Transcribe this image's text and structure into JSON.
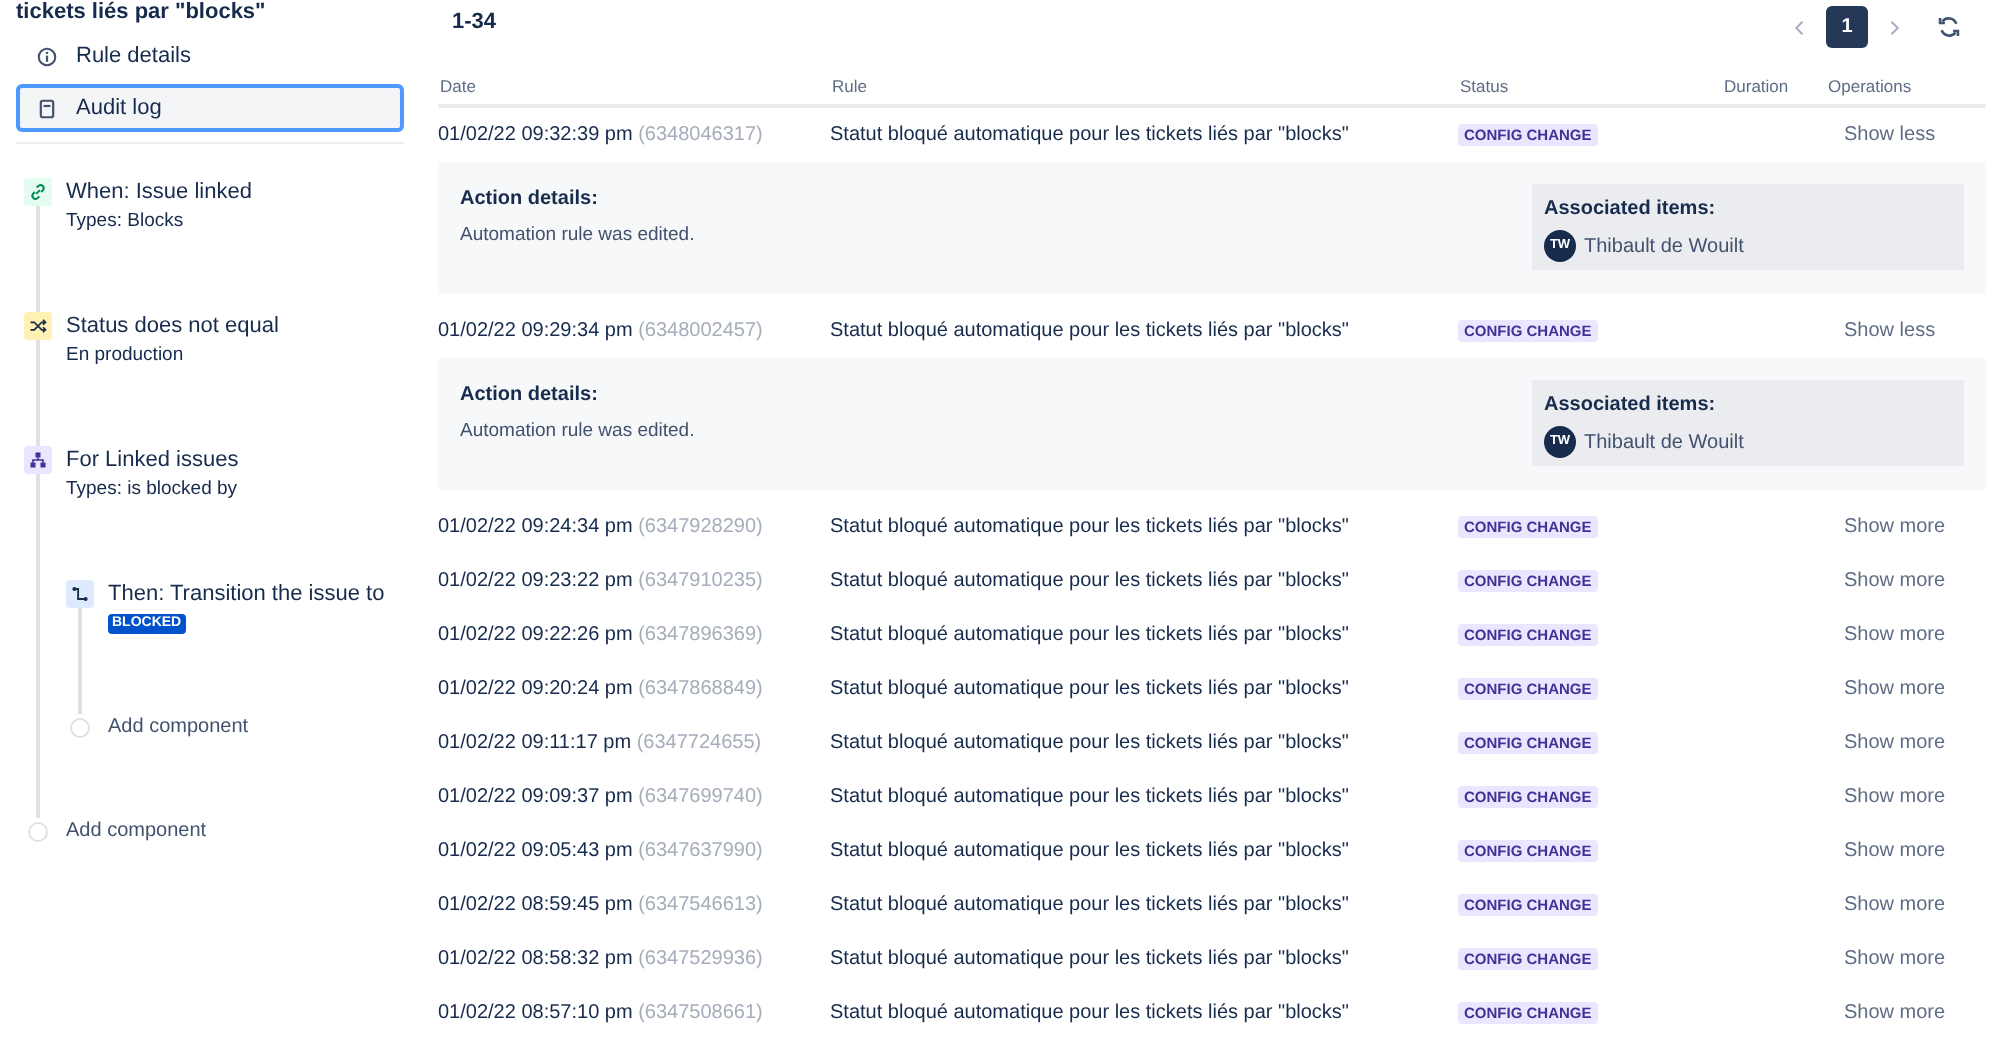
{
  "rule_title": "tickets liés par \"blocks\"",
  "nav": [
    {
      "kind": "info",
      "label": "Rule details",
      "selected": false
    },
    {
      "kind": "log",
      "label": "Audit log",
      "selected": true
    }
  ],
  "flow": [
    {
      "kind": "trigger",
      "title": "When: Issue linked",
      "detail": "Types: Blocks"
    },
    {
      "kind": "condition",
      "title": "Status does not equal",
      "detail": "En production"
    },
    {
      "kind": "branch",
      "title": "For Linked issues",
      "detail": "Types: is blocked by",
      "children": [
        {
          "kind": "action",
          "title": "Then: Transition the issue to",
          "lozenge": "BLOCKED"
        },
        {
          "kind": "add",
          "title": "Add component"
        }
      ]
    },
    {
      "kind": "add",
      "title": "Add component"
    }
  ],
  "audit_log": {
    "range": "1-34",
    "pages": [
      {
        "label": "1",
        "selected": true
      }
    ],
    "columns": [
      "Date",
      "Rule",
      "Status",
      "Duration",
      "Operations"
    ],
    "rows": [
      {
        "date": "01/02/22 09:32:39 pm",
        "id": "(6348046317)",
        "rule": "Statut bloqué automatique pour les tickets liés par \"blocks\"",
        "status": "CONFIG CHANGE",
        "operation": "Show less",
        "expanded": true,
        "details": {
          "label": "Action details:",
          "text": "Automation rule was edited.",
          "associated_label": "Associated items:",
          "initials": "TW",
          "user": "Thibault de Wouilt"
        }
      },
      {
        "date": "01/02/22 09:29:34 pm",
        "id": "(6348002457)",
        "rule": "Statut bloqué automatique pour les tickets liés par \"blocks\"",
        "status": "CONFIG CHANGE",
        "operation": "Show less",
        "expanded": true,
        "details": {
          "label": "Action details:",
          "text": "Automation rule was edited.",
          "associated_label": "Associated items:",
          "initials": "TW",
          "user": "Thibault de Wouilt"
        }
      },
      {
        "date": "01/02/22 09:24:34 pm",
        "id": "(6347928290)",
        "rule": "Statut bloqué automatique pour les tickets liés par \"blocks\"",
        "status": "CONFIG CHANGE",
        "operation": "Show more",
        "expanded": false
      },
      {
        "date": "01/02/22 09:23:22 pm",
        "id": "(6347910235)",
        "rule": "Statut bloqué automatique pour les tickets liés par \"blocks\"",
        "status": "CONFIG CHANGE",
        "operation": "Show more",
        "expanded": false
      },
      {
        "date": "01/02/22 09:22:26 pm",
        "id": "(6347896369)",
        "rule": "Statut bloqué automatique pour les tickets liés par \"blocks\"",
        "status": "CONFIG CHANGE",
        "operation": "Show more",
        "expanded": false
      },
      {
        "date": "01/02/22 09:20:24 pm",
        "id": "(6347868849)",
        "rule": "Statut bloqué automatique pour les tickets liés par \"blocks\"",
        "status": "CONFIG CHANGE",
        "operation": "Show more",
        "expanded": false
      },
      {
        "date": "01/02/22 09:11:17 pm",
        "id": "(6347724655)",
        "rule": "Statut bloqué automatique pour les tickets liés par \"blocks\"",
        "status": "CONFIG CHANGE",
        "operation": "Show more",
        "expanded": false
      },
      {
        "date": "01/02/22 09:09:37 pm",
        "id": "(6347699740)",
        "rule": "Statut bloqué automatique pour les tickets liés par \"blocks\"",
        "status": "CONFIG CHANGE",
        "operation": "Show more",
        "expanded": false
      },
      {
        "date": "01/02/22 09:05:43 pm",
        "id": "(6347637990)",
        "rule": "Statut bloqué automatique pour les tickets liés par \"blocks\"",
        "status": "CONFIG CHANGE",
        "operation": "Show more",
        "expanded": false
      },
      {
        "date": "01/02/22 08:59:45 pm",
        "id": "(6347546613)",
        "rule": "Statut bloqué automatique pour les tickets liés par \"blocks\"",
        "status": "CONFIG CHANGE",
        "operation": "Show more",
        "expanded": false
      },
      {
        "date": "01/02/22 08:58:32 pm",
        "id": "(6347529936)",
        "rule": "Statut bloqué automatique pour les tickets liés par \"blocks\"",
        "status": "CONFIG CHANGE",
        "operation": "Show more",
        "expanded": false
      },
      {
        "date": "01/02/22 08:57:10 pm",
        "id": "(6347508661)",
        "rule": "Statut bloqué automatique pour les tickets liés par \"blocks\"",
        "status": "CONFIG CHANGE",
        "operation": "Show more",
        "expanded": false
      }
    ]
  }
}
